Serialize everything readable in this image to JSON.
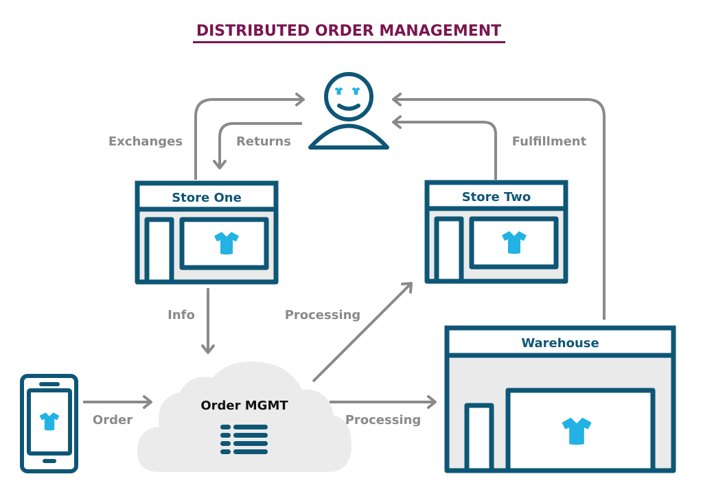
{
  "title": "DISTRIBUTED ORDER MANAGEMENT",
  "colors": {
    "title": "#7a1550",
    "primary": "#0e5676",
    "accent": "#22b2e3",
    "arrow": "#8a8a8a",
    "fill": "#eaeaea"
  },
  "nodes": {
    "customer": {
      "label": "Customer",
      "icon": "person-icon"
    },
    "store_one": {
      "label": "Store One",
      "icon": "storefront-icon"
    },
    "store_two": {
      "label": "Store Two",
      "icon": "storefront-icon"
    },
    "warehouse": {
      "label": "Warehouse",
      "icon": "warehouse-icon"
    },
    "mobile": {
      "label": "Mobile Device",
      "icon": "smartphone-icon"
    },
    "order_mgmt": {
      "label": "Order MGMT",
      "icon": "list-icon"
    }
  },
  "edges": {
    "exchanges": {
      "label": "Exchanges",
      "from": "Store One",
      "to": "Customer"
    },
    "returns": {
      "label": "Returns",
      "from": "Customer",
      "to": "Store One"
    },
    "fulfillment": {
      "label": "Fulfillment",
      "from": "Store Two / Warehouse",
      "to": "Customer"
    },
    "info": {
      "label": "Info",
      "from": "Store One",
      "to": "Order MGMT"
    },
    "order": {
      "label": "Order",
      "from": "Mobile Device",
      "to": "Order MGMT"
    },
    "processing_store": {
      "label": "Processing",
      "from": "Order MGMT",
      "to": "Store Two"
    },
    "processing_warehouse": {
      "label": "Processing",
      "from": "Order MGMT",
      "to": "Warehouse"
    }
  }
}
